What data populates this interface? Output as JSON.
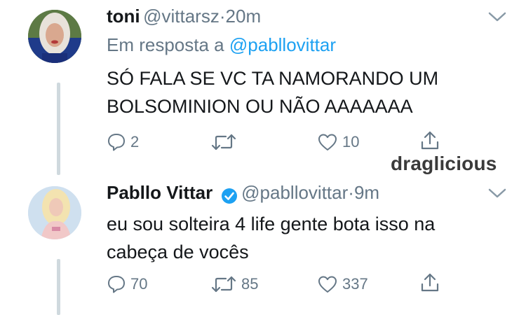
{
  "tweets": [
    {
      "display_name": "toni",
      "handle": "@vittarsz",
      "separator": "·",
      "time": "20m",
      "reply_prefix": "Em resposta a",
      "reply_to": "@pabllovittar",
      "text_line1": "SÓ FALA SE VC TA NAMORANDO UM",
      "text_line2": "BOLSOMINION OU NÃO AAAAAAA",
      "replies": "2",
      "retweets": "",
      "likes": "10"
    },
    {
      "display_name": "Pabllo Vittar",
      "verified": true,
      "handle": "@pabllovittar",
      "separator": "·",
      "time": "9m",
      "text_line1": "eu sou solteira 4 life gente bota isso na",
      "text_line2": "cabeça de vocês",
      "replies": "70",
      "retweets": "85",
      "likes": "337"
    }
  ],
  "watermark": "draglicious",
  "colors": {
    "accent": "#1da1f2",
    "muted": "#657786",
    "text": "#14171a",
    "thread_line": "#cfd9de"
  },
  "icons": [
    "reply-icon",
    "retweet-icon",
    "like-icon",
    "share-icon",
    "chevron-down-icon",
    "verified-badge-icon"
  ]
}
